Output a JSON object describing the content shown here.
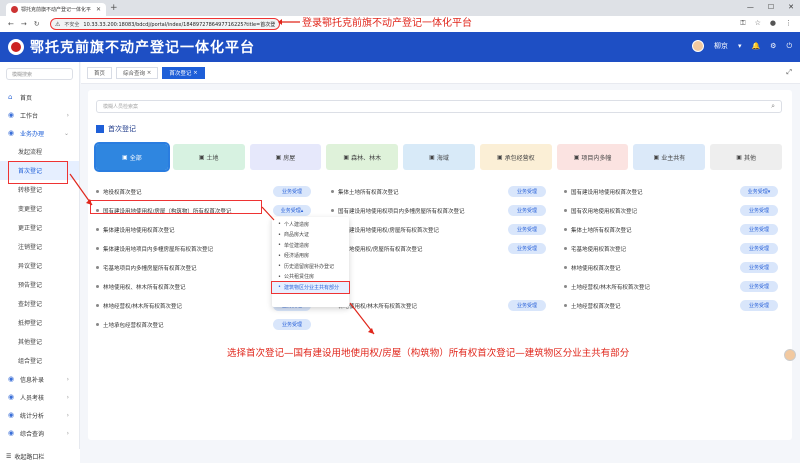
{
  "browser": {
    "tab_title": "鄂托克前旗不动产登记一体化平",
    "security_label": "不安全",
    "url": "10.33.33.200:18083/bdcdj/portal/index/1848972786497716225?title=首次登记"
  },
  "annotations": {
    "top": "登录鄂托克前旗不动产登记一体化平台",
    "bottom": "选择首次登记—国有建设用地使用权/房屋（构筑物）所有权首次登记—建筑物区分业主共有部分"
  },
  "header": {
    "title": "鄂托克前旗不动产登记一体化平台",
    "user": "柳京"
  },
  "sidebar": {
    "search_placeholder": "模糊搜索",
    "home": "首页",
    "workbench": "工作台",
    "business": "业务办理",
    "subitems": [
      "发起流程",
      "首次登记",
      "转移登记",
      "变更登记",
      "更正登记",
      "注销登记",
      "异议登记",
      "预告登记",
      "查封登记",
      "抵押登记",
      "其他登记",
      "组合登记"
    ],
    "bottom_items": [
      "信息补录",
      "人员考核",
      "统计分析",
      "综合查询",
      "其它业务"
    ],
    "collapse": "收起路口栏"
  },
  "page_tabs": [
    "首页",
    "综合查询",
    "首次登记"
  ],
  "main": {
    "search_placeholder": "模糊人员检索案",
    "section_title": "首次登记",
    "categories": [
      {
        "label": "全部",
        "color": "#2f86e0"
      },
      {
        "label": "土地",
        "color": "#d7f2e1"
      },
      {
        "label": "房屋",
        "color": "#e6e8fb"
      },
      {
        "label": "森林、林木",
        "color": "#dff2da"
      },
      {
        "label": "海域",
        "color": "#d8eaf8"
      },
      {
        "label": "承包经营权",
        "color": "#fbefd6"
      },
      {
        "label": "项目内多幢",
        "color": "#fbe3e1"
      },
      {
        "label": "业主共有",
        "color": "#dbe9f9"
      },
      {
        "label": "其他",
        "color": "#eeeeee"
      }
    ],
    "button_label": "业务受理",
    "rows": [
      [
        "地役权首次登记",
        "集体土地所有权首次登记",
        "国有建设用地使用权首次登记"
      ],
      [
        "国有建设用地使用权/房屋（构筑物）所有权首次登记",
        "国有建设用地使用权项目内多幢房屋所有权首次登记",
        "国有农用地使用权首次登记"
      ],
      [
        "集体建设用地使用权首次登记",
        "集体建设用地使用权/房屋所有权首次登记",
        "集体土地所有权首次登记"
      ],
      [
        "集体建设用地项目内多幢房屋所有权首次登记",
        "宅基地使用权/房屋所有权首次登记",
        "宅基地使用权首次登记"
      ],
      [
        "宅基地项目内多幢房屋所有权首次登记",
        "",
        "林地使用权首次登记"
      ],
      [
        "林地使用权、林木所有权首次登记",
        "",
        "土地经营权/林木所有权首次登记"
      ],
      [
        "林地经营权/林木所有权首次登记",
        "林地使用权/林木所有权首次登记",
        "土地经营权首次登记"
      ],
      [
        "土地承包经营权首次登记",
        "",
        ""
      ]
    ],
    "dropdown": [
      "个人建造房",
      "商品房大证",
      "单位建造房",
      "经济适用房",
      "历史遗留房屋补办登记",
      "公共租赁住房",
      "建筑物区分业主共有部分"
    ]
  }
}
